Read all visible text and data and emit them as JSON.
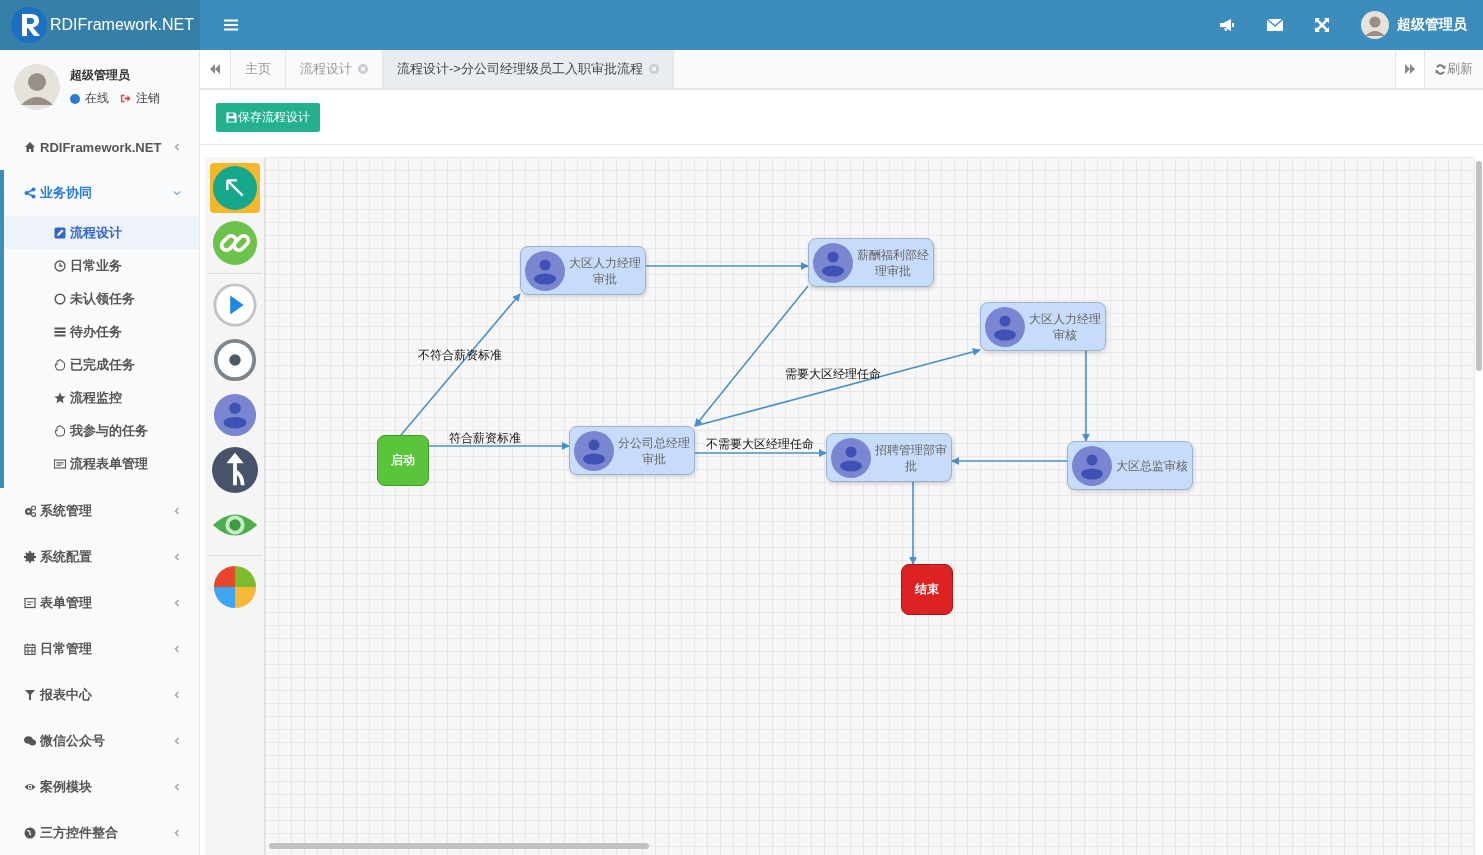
{
  "header": {
    "brand": "RDIFramework.NET",
    "user_name": "超级管理员"
  },
  "user_panel": {
    "name": "超级管理员",
    "status": "在线",
    "logout": "注销"
  },
  "sidebar": {
    "items": [
      {
        "label": "RDIFramework.NET",
        "expanded": false
      },
      {
        "label": "业务协同",
        "expanded": true,
        "children": [
          {
            "label": "流程设计",
            "selected": true
          },
          {
            "label": "日常业务",
            "selected": false
          },
          {
            "label": "未认领任务",
            "selected": false
          },
          {
            "label": "待办任务",
            "selected": false
          },
          {
            "label": "已完成任务",
            "selected": false
          },
          {
            "label": "流程监控",
            "selected": false
          },
          {
            "label": "我参与的任务",
            "selected": false
          },
          {
            "label": "流程表单管理",
            "selected": false
          }
        ]
      },
      {
        "label": "系统管理",
        "expanded": false
      },
      {
        "label": "系统配置",
        "expanded": false
      },
      {
        "label": "表单管理",
        "expanded": false
      },
      {
        "label": "日常管理",
        "expanded": false
      },
      {
        "label": "报表中心",
        "expanded": false
      },
      {
        "label": "微信公众号",
        "expanded": false
      },
      {
        "label": "案例模块",
        "expanded": false
      },
      {
        "label": "三方控件整合",
        "expanded": false
      }
    ]
  },
  "tabs": [
    {
      "label": "主页",
      "closable": false,
      "selected": false
    },
    {
      "label": "流程设计",
      "closable": true,
      "selected": false
    },
    {
      "label": "流程设计->分公司经理级员工入职审批流程",
      "closable": true,
      "selected": true
    }
  ],
  "refresh": "刷新",
  "toolbar": {
    "save_button": "保存流程设计"
  },
  "palette": [
    {
      "kind": "select",
      "selected": true
    },
    {
      "kind": "link",
      "selected": false
    },
    {
      "kind": "start",
      "selected": false
    },
    {
      "kind": "end",
      "selected": false
    },
    {
      "kind": "task",
      "selected": false
    },
    {
      "kind": "fork",
      "selected": false
    },
    {
      "kind": "view",
      "selected": false
    },
    {
      "kind": "pie",
      "selected": false
    }
  ],
  "flow": {
    "nodes": [
      {
        "kind": "start",
        "label": "启动"
      },
      {
        "kind": "task",
        "label": "大区人力经理审批"
      },
      {
        "kind": "task",
        "label": "薪酬福利部经理审批"
      },
      {
        "kind": "task",
        "label": "大区人力经理审核"
      },
      {
        "kind": "task",
        "label": "分公司总经理审批"
      },
      {
        "kind": "task",
        "label": "招聘管理部审批"
      },
      {
        "kind": "task",
        "label": "大区总监审核"
      },
      {
        "kind": "end",
        "label": "结束"
      }
    ],
    "edge_labels": [
      "不符合薪资标准",
      "符合薪资标准",
      "需要大区经理任命",
      "不需要大区经理任命"
    ]
  }
}
